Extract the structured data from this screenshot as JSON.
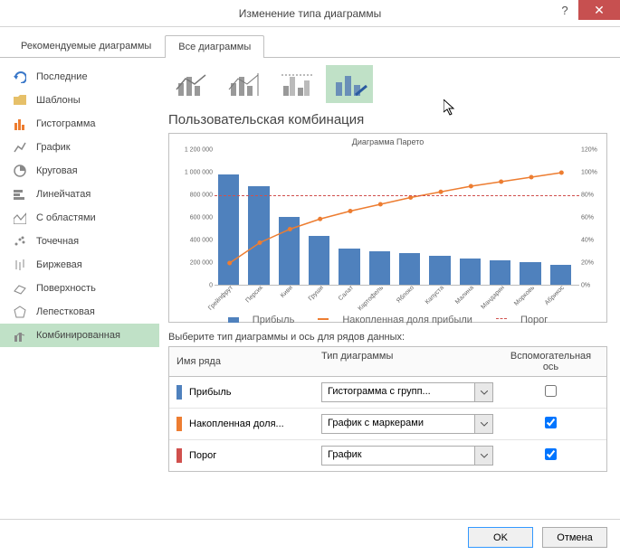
{
  "window": {
    "title": "Изменение типа диаграммы"
  },
  "tabs": {
    "recommended": "Рекомендуемые диаграммы",
    "all": "Все диаграммы"
  },
  "sidebar": {
    "items": [
      {
        "label": "Последние"
      },
      {
        "label": "Шаблоны"
      },
      {
        "label": "Гистограмма"
      },
      {
        "label": "График"
      },
      {
        "label": "Круговая"
      },
      {
        "label": "Линейчатая"
      },
      {
        "label": "С областями"
      },
      {
        "label": "Точечная"
      },
      {
        "label": "Биржевая"
      },
      {
        "label": "Поверхность"
      },
      {
        "label": "Лепестковая"
      },
      {
        "label": "Комбинированная"
      }
    ]
  },
  "main": {
    "section_title": "Пользовательская комбинация",
    "series_prompt": "Выберите тип диаграммы и ось для рядов данных:",
    "cols": {
      "name": "Имя ряда",
      "type": "Тип диаграммы",
      "axis": "Вспомогательная ось"
    },
    "series": [
      {
        "name": "Прибыль",
        "type": "Гистограмма с групп...",
        "color": "#4f81bd",
        "secondary": false
      },
      {
        "name": "Накопленная доля...",
        "type": "График с маркерами",
        "color": "#ed7d31",
        "secondary": true
      },
      {
        "name": "Порог",
        "type": "График",
        "color": "#d0504d",
        "secondary": true
      }
    ]
  },
  "chart_data": {
    "type": "combo",
    "title": "Диаграмма Парето",
    "categories": [
      "Грейпфрут",
      "Персик",
      "Киви",
      "Груши",
      "Салат",
      "Картофель",
      "Яблоко",
      "Капуста",
      "Малина",
      "Мандарин",
      "Морковь",
      "Абрикос"
    ],
    "series": [
      {
        "name": "Прибыль",
        "type": "bar",
        "color": "#4f81bd",
        "values": [
          980000,
          870000,
          600000,
          430000,
          320000,
          300000,
          280000,
          260000,
          230000,
          220000,
          200000,
          180000
        ]
      },
      {
        "name": "Накопленная доля прибыли",
        "type": "line_marker",
        "color": "#ed7d31",
        "axis": "secondary",
        "values": [
          20,
          38,
          50,
          59,
          66,
          72,
          78,
          83,
          88,
          92,
          96,
          100
        ]
      },
      {
        "name": "Порог",
        "type": "line_dashed",
        "color": "#d0504d",
        "axis": "secondary",
        "values": [
          80,
          80,
          80,
          80,
          80,
          80,
          80,
          80,
          80,
          80,
          80,
          80
        ]
      }
    ],
    "y1": {
      "min": 0,
      "max": 1200000,
      "step": 200000
    },
    "y2": {
      "min": 0,
      "max": 120,
      "step": 20,
      "suffix": "%"
    },
    "legend": [
      "Прибыль",
      "Накопленная доля прибыли",
      "Порог"
    ]
  },
  "footer": {
    "ok": "OK",
    "cancel": "Отмена"
  }
}
